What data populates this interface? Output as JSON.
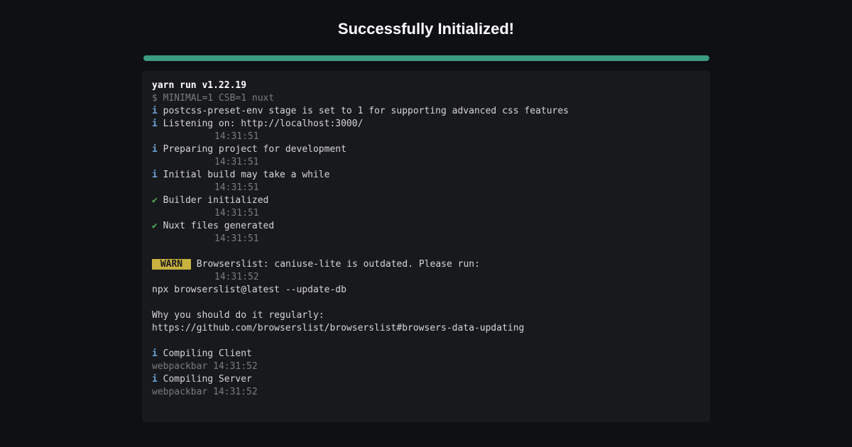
{
  "title": "Successfully Initialized!",
  "terminal": {
    "version": "yarn run v1.22.19",
    "command": "$ MINIMAL=1 CSB=1 nuxt",
    "info_prefix": "i",
    "check_prefix": "✔",
    "warn_badge": " WARN ",
    "postcss_msg": " postcss-preset-env stage is set to 1 for supporting advanced css features",
    "listening_msg": " Listening on: http://localhost:3000/",
    "preparing_msg": " Preparing project for development",
    "initial_build_msg": " Initial build may take a while",
    "builder_init_msg": "Builder initialized",
    "nuxt_files_msg": "Nuxt files generated",
    "browserslist_msg": " Browserslist: caniuse-lite is outdated. Please run:",
    "npx_cmd": "npx browserslist@latest --update-db",
    "why_msg": "Why you should do it regularly:",
    "github_url": "https://github.com/browserslist/browserslist#browsers-data-updating",
    "compiling_client": " Compiling Client",
    "compiling_server": " Compiling Server",
    "ts1": "14:31:51",
    "ts2": "14:31:52",
    "webpackbar_src": "webpackbar 14:31:52"
  }
}
